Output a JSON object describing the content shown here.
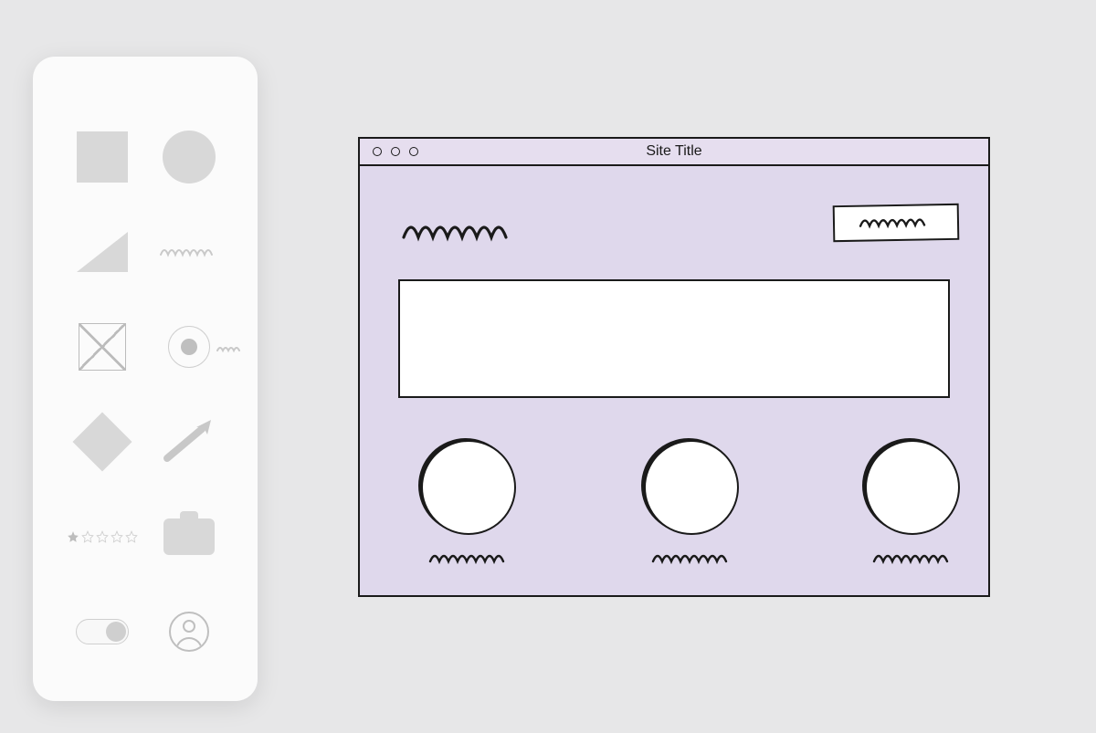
{
  "palette": {
    "shapes": [
      "square",
      "circle",
      "triangle",
      "scribble",
      "image-placeholder",
      "radio",
      "diamond",
      "arrow",
      "star-rating",
      "card",
      "toggle",
      "avatar"
    ]
  },
  "mockup": {
    "window_title": "Site Title",
    "logo_placeholder": "squiggle",
    "cta_button_placeholder": "squiggle",
    "hero_placeholder": "image",
    "features": [
      {
        "icon": "circle",
        "label_placeholder": "squiggle"
      },
      {
        "icon": "circle",
        "label_placeholder": "squiggle"
      },
      {
        "icon": "circle",
        "label_placeholder": "squiggle"
      }
    ]
  }
}
